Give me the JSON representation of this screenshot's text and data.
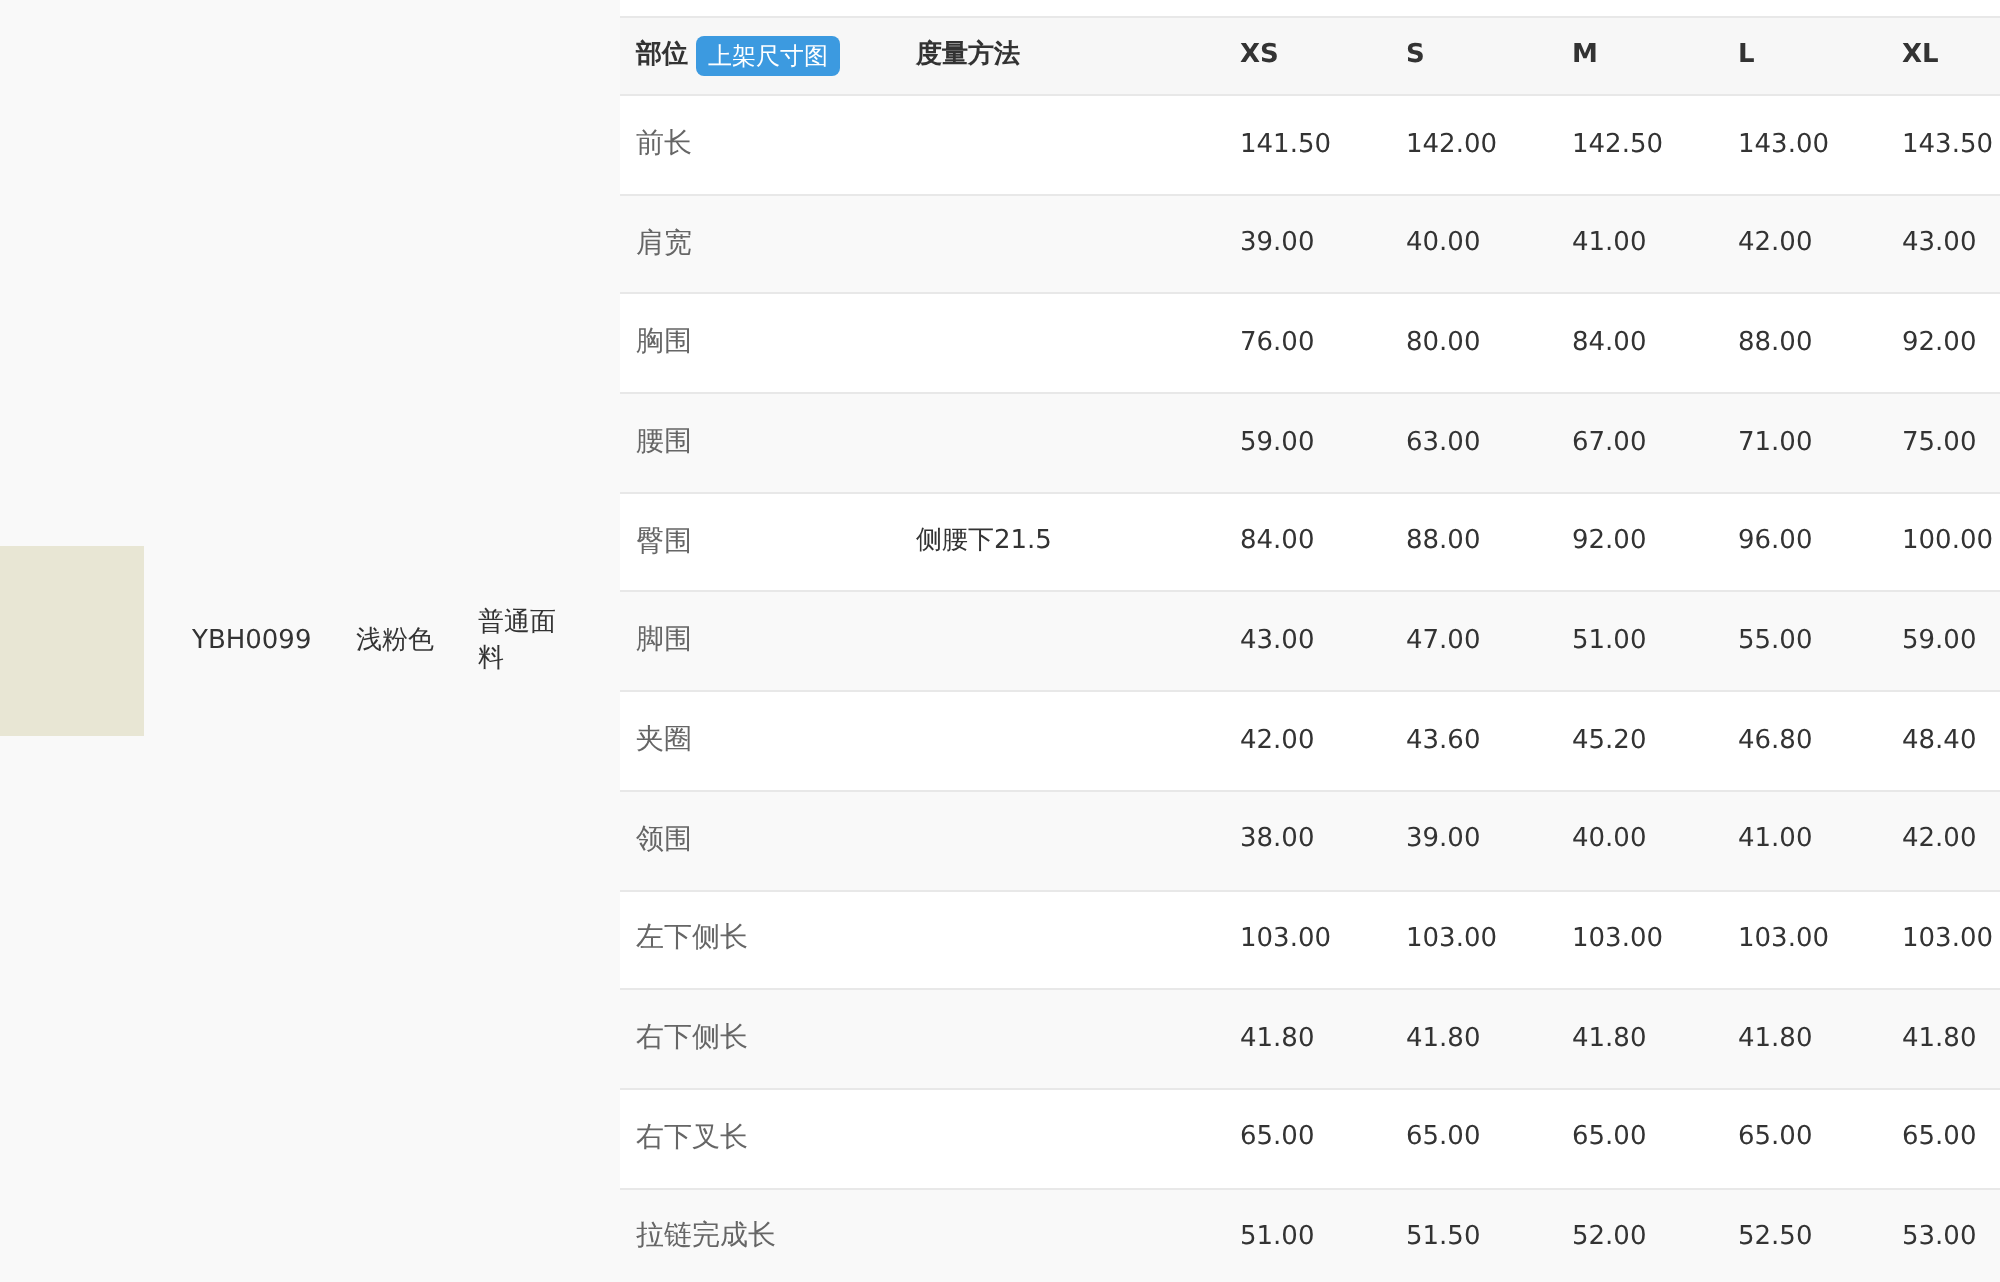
{
  "product": {
    "code": "YBH0099",
    "color_name": "浅粉色",
    "fabric": "普通面料"
  },
  "table": {
    "columns": [
      {
        "label": "部位",
        "badge": "上架尺寸图"
      },
      {
        "label": "度量方法"
      },
      {
        "label": "XS"
      },
      {
        "label": "S"
      },
      {
        "label": "M"
      },
      {
        "label": "L"
      },
      {
        "label": "XL"
      }
    ],
    "rows": [
      {
        "part": "前长",
        "method": "",
        "values": [
          "141.50",
          "142.00",
          "142.50",
          "143.00",
          "143.50"
        ]
      },
      {
        "part": "肩宽",
        "method": "",
        "values": [
          "39.00",
          "40.00",
          "41.00",
          "42.00",
          "43.00"
        ]
      },
      {
        "part": "胸围",
        "method": "",
        "values": [
          "76.00",
          "80.00",
          "84.00",
          "88.00",
          "92.00"
        ]
      },
      {
        "part": "腰围",
        "method": "",
        "values": [
          "59.00",
          "63.00",
          "67.00",
          "71.00",
          "75.00"
        ]
      },
      {
        "part": "臀围",
        "method": "侧腰下21.5",
        "values": [
          "84.00",
          "88.00",
          "92.00",
          "96.00",
          "100.00"
        ]
      },
      {
        "part": "脚围",
        "method": "",
        "values": [
          "43.00",
          "47.00",
          "51.00",
          "55.00",
          "59.00"
        ]
      },
      {
        "part": "夹圈",
        "method": "",
        "values": [
          "42.00",
          "43.60",
          "45.20",
          "46.80",
          "48.40"
        ]
      },
      {
        "part": "领围",
        "method": "",
        "values": [
          "38.00",
          "39.00",
          "40.00",
          "41.00",
          "42.00"
        ]
      },
      {
        "part": "左下侧长",
        "method": "",
        "values": [
          "103.00",
          "103.00",
          "103.00",
          "103.00",
          "103.00"
        ]
      },
      {
        "part": "右下侧长",
        "method": "",
        "values": [
          "41.80",
          "41.80",
          "41.80",
          "41.80",
          "41.80"
        ]
      },
      {
        "part": "右下叉长",
        "method": "",
        "values": [
          "65.00",
          "65.00",
          "65.00",
          "65.00",
          "65.00"
        ]
      },
      {
        "part": "拉链完成长",
        "method": "",
        "values": [
          "51.00",
          "51.50",
          "52.00",
          "52.50",
          "53.00"
        ]
      }
    ]
  }
}
